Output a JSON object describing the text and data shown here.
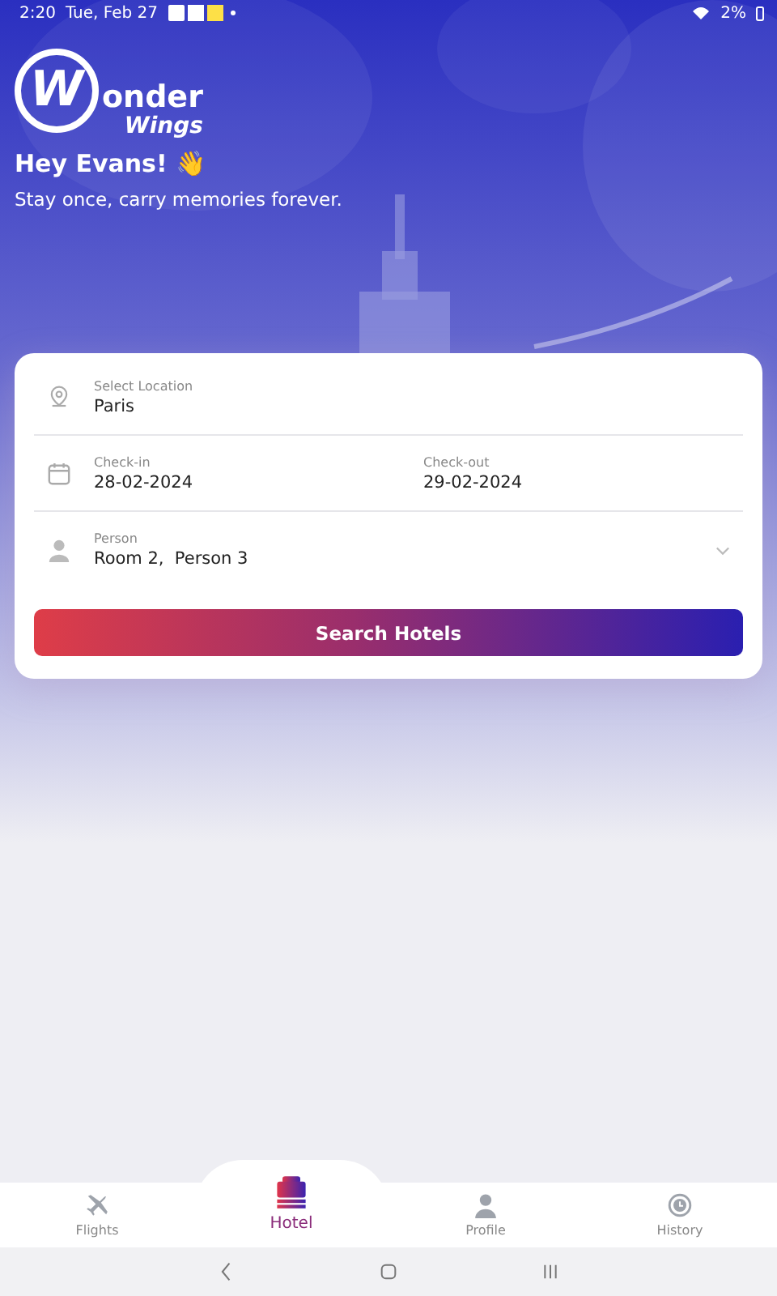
{
  "status_bar": {
    "time": "2:20",
    "date": "Tue, Feb 27",
    "battery": "2%"
  },
  "logo": {
    "initial": "W",
    "word": "onder",
    "subword": "Wings"
  },
  "greeting": {
    "title": "Hey Evans! 👋",
    "subtitle": "Stay once, carry memories forever."
  },
  "form": {
    "location": {
      "label": "Select Location",
      "value": "Paris"
    },
    "check_in": {
      "label": "Check-in",
      "value": "28-02-2024"
    },
    "check_out": {
      "label": "Check-out",
      "value": "29-02-2024"
    },
    "person": {
      "label": "Person",
      "value": "Room 2,  Person 3"
    },
    "button": "Search Hotels"
  },
  "bottom_nav": [
    {
      "kind": "flights",
      "label": "Flights",
      "selected": false
    },
    {
      "kind": "hotel",
      "label": "Hotel",
      "selected": true
    },
    {
      "kind": "profile",
      "label": "Profile",
      "selected": false
    },
    {
      "kind": "history",
      "label": "History",
      "selected": false
    }
  ]
}
